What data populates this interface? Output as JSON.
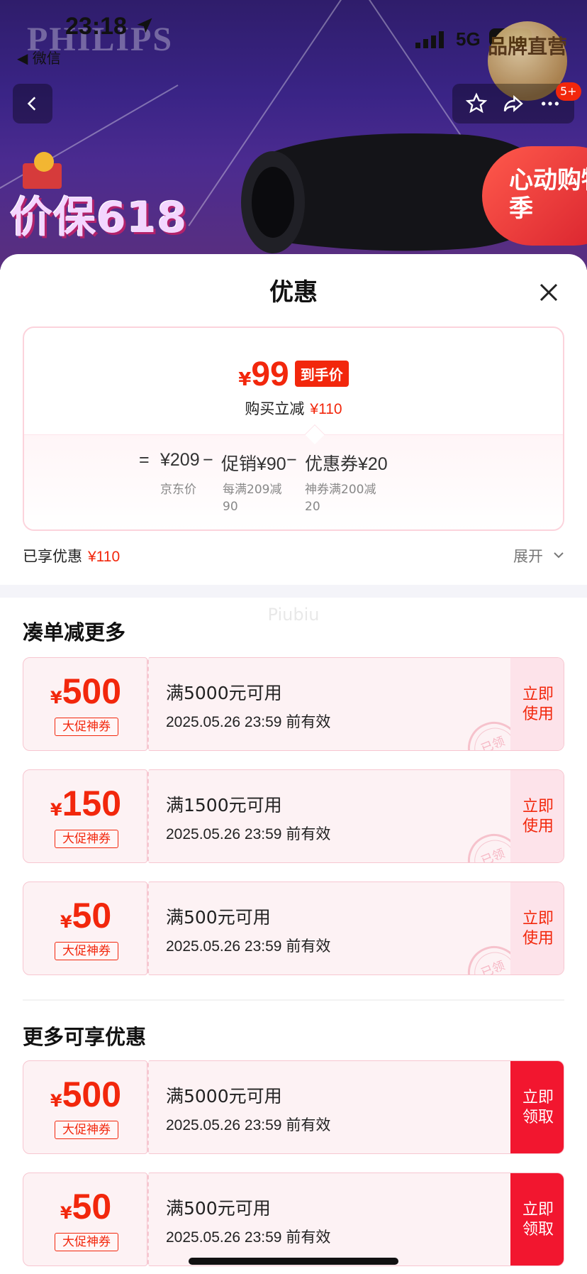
{
  "status_bar": {
    "time": "23:18",
    "back_app": "◀ 微信",
    "network": "5G"
  },
  "banner": {
    "brand": "PHILIPS",
    "self_operated_badge": "品牌直营",
    "promo_badge": "心动购物季",
    "price_protect_text": "价保618",
    "message_badge": "5+",
    "colors": {
      "banner_top": "#2f1d6b",
      "banner_bottom": "#5a2f7e"
    }
  },
  "sheet": {
    "title": "优惠",
    "summary": {
      "currency": "¥",
      "final_price": "99",
      "final_tag": "到手价",
      "save_label": "购买立减",
      "save_amount": "¥110",
      "calc": [
        {
          "op": "=",
          "value": "¥209",
          "sub": "京东价"
        },
        {
          "op": "−",
          "value": "促销¥90",
          "sub": "每满209减 90"
        },
        {
          "op": "−",
          "value": "优惠券¥20",
          "sub": "神券满200减 20"
        }
      ]
    },
    "enjoyed_label": "已享优惠",
    "enjoyed_amount": "¥110",
    "expand_label": "展开",
    "watermark": "Piubiu"
  },
  "section_more_orders": {
    "title": "凑单减更多",
    "coupons": [
      {
        "amount": "500",
        "label": "大促神券",
        "condition": "满5000元可用",
        "date": "2025.05.26 23:59",
        "date_suffix": "前有效",
        "action": "立即使用",
        "stamp": "已领"
      },
      {
        "amount": "150",
        "label": "大促神券",
        "condition": "满1500元可用",
        "date": "2025.05.26 23:59",
        "date_suffix": "前有效",
        "action": "立即使用",
        "stamp": "已领"
      },
      {
        "amount": "50",
        "label": "大促神券",
        "condition": "满500元可用",
        "date": "2025.05.26 23:59",
        "date_suffix": "前有效",
        "action": "立即使用",
        "stamp": "已领"
      }
    ]
  },
  "section_more_offers": {
    "title": "更多可享优惠",
    "coupons": [
      {
        "amount": "500",
        "label": "大促神券",
        "condition": "满5000元可用",
        "date": "2025.05.26 23:59",
        "date_suffix": "前有效",
        "action": "立即领取"
      },
      {
        "amount": "50",
        "label": "大促神券",
        "condition": "满500元可用",
        "date": "2025.05.26 23:59",
        "date_suffix": "前有效",
        "action": "立即领取"
      }
    ]
  },
  "colors": {
    "accent_red": "#f2270c",
    "coupon_bg": "#fdf2f4",
    "coupon_border": "#f7c6d0"
  }
}
